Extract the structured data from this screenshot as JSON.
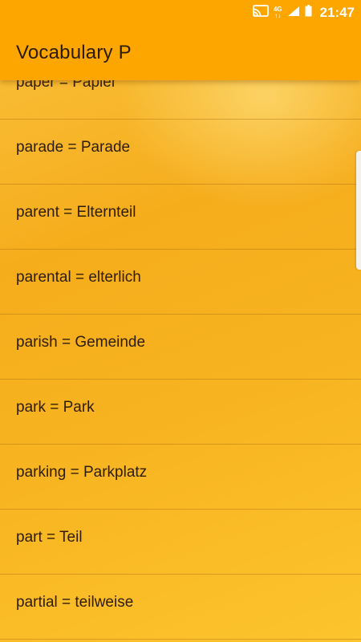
{
  "status_bar": {
    "network_label": "4G",
    "time": "21:47"
  },
  "app_bar": {
    "title": "Vocabulary P"
  },
  "list": {
    "items": [
      {
        "text": "paper = Papier"
      },
      {
        "text": "parade = Parade"
      },
      {
        "text": "parent = Elternteil"
      },
      {
        "text": "parental = elterlich"
      },
      {
        "text": "parish = Gemeinde"
      },
      {
        "text": "park = Park"
      },
      {
        "text": "parking = Parkplatz"
      },
      {
        "text": "part = Teil"
      },
      {
        "text": "partial = teilweise"
      }
    ]
  }
}
